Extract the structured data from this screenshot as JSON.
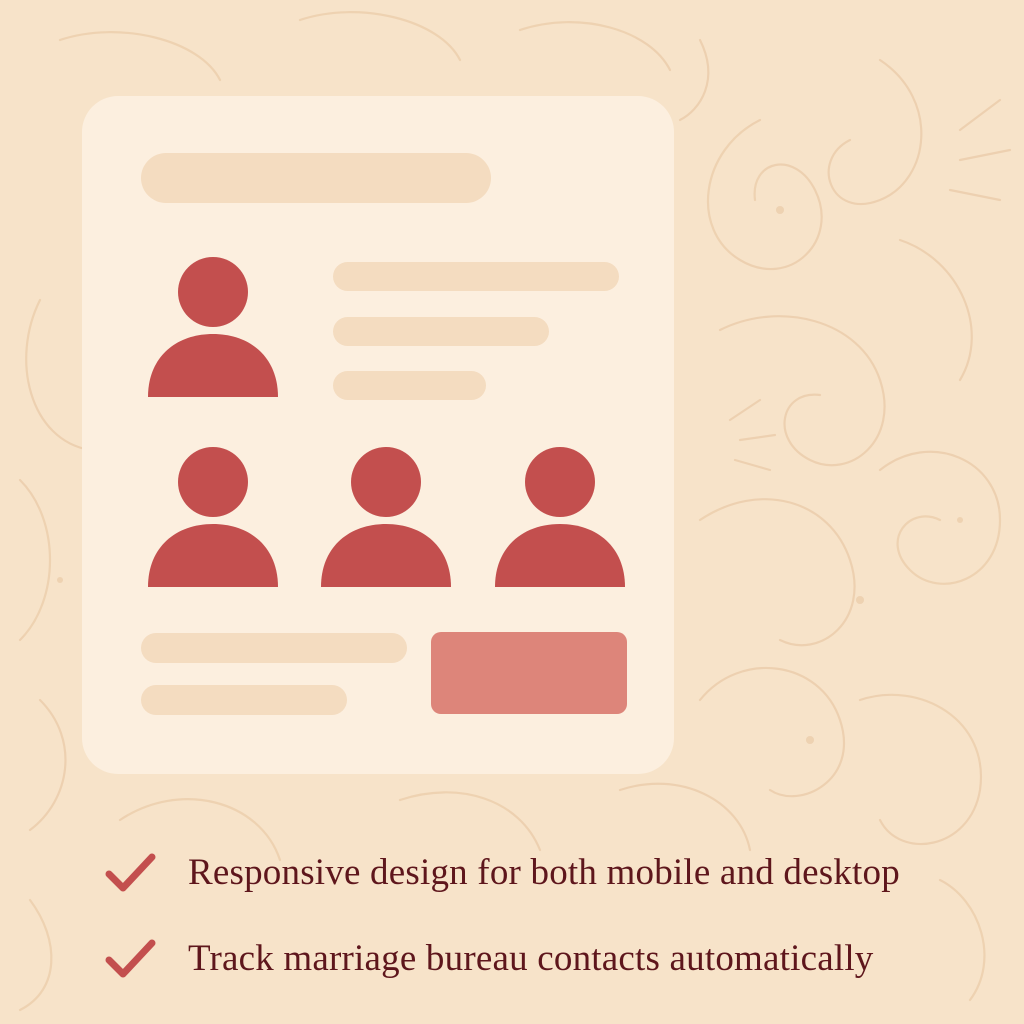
{
  "colors": {
    "background": "#f7e3c9",
    "card": "#fcefdf",
    "placeholder": "#f4dcc0",
    "avatar": "#c34f4e",
    "button": "#dd857a",
    "text": "#5e161c",
    "pattern": "#eccfae"
  },
  "card": {
    "avatars": [
      "user-icon",
      "user-icon",
      "user-icon",
      "user-icon"
    ],
    "button_icon": "placeholder-button"
  },
  "features": [
    {
      "icon": "checkmark-icon",
      "text": "Responsive design for both mobile and desktop"
    },
    {
      "icon": "checkmark-icon",
      "text": "Track marriage bureau contacts automatically"
    }
  ]
}
